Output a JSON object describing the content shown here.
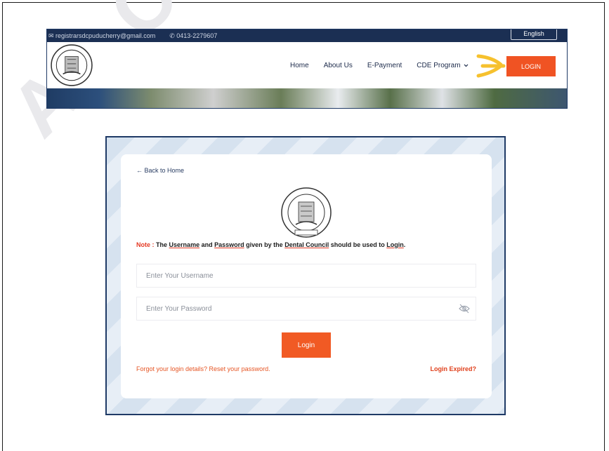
{
  "watermark_text": "AL CO",
  "top_screenshot": {
    "email": "✉ registrarsdcpuducherry@gmail.com",
    "phone": "✆ 0413-2279607",
    "language": "English",
    "logo_icon": "dental-council-seal-icon",
    "nav_items": [
      "Home",
      "About Us",
      "E-Payment",
      "CDE Program"
    ],
    "cde_dropdown_icon": "chevron-down-icon",
    "pointer_icon": "yellow-arrow-icon",
    "login_label": "LOGIN",
    "accent_color": "#f05323",
    "header_color": "#1b2f53"
  },
  "login_page": {
    "back_link": "← Back to Home",
    "logo_icon": "dental-council-seal-icon",
    "note": {
      "prefix": "Note :",
      "t1": "The",
      "username": "Username",
      "t2": "and",
      "password": "Password",
      "t3": "given by the",
      "council": "Dental Council",
      "t4": "should be used to",
      "login": "Login",
      "end": "."
    },
    "username_placeholder": "Enter Your Username",
    "password_placeholder": "Enter Your Password",
    "eye_icon": "eye-off-icon",
    "login_button": "Login",
    "forgot_link": "Forgot your login details? Reset your password.",
    "expired_link": "Login Expired?",
    "button_color": "#f15a24"
  }
}
